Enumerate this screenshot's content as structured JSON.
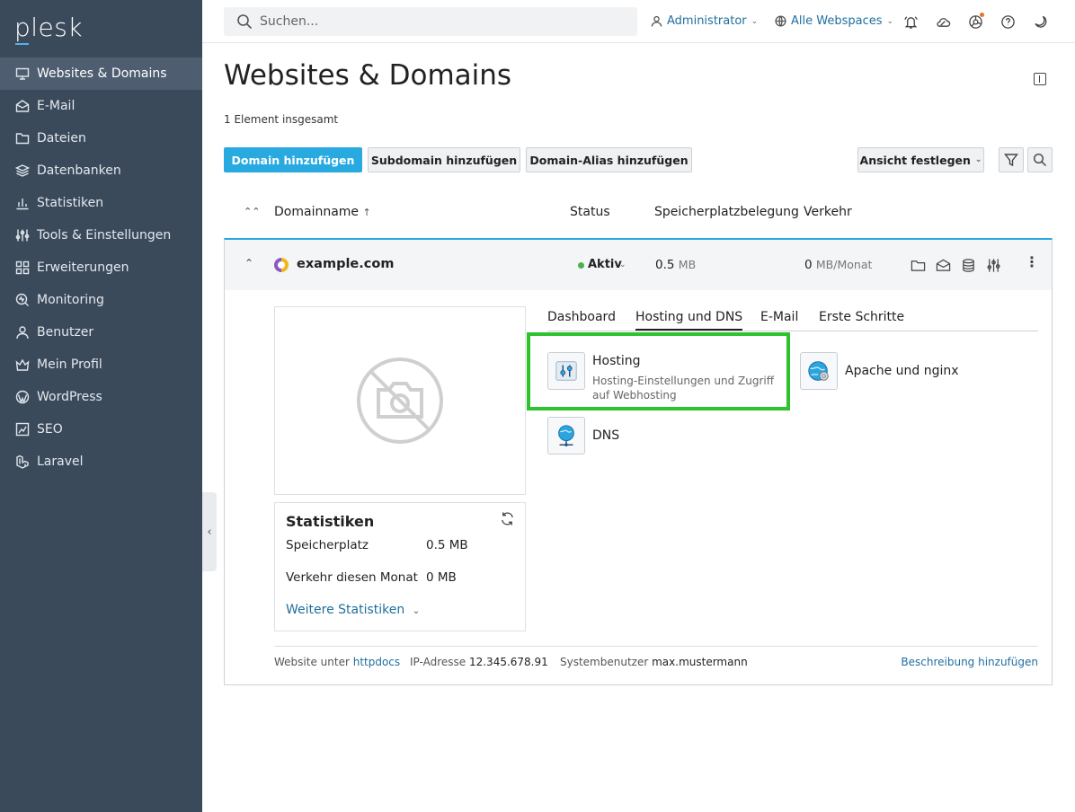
{
  "app": {
    "logo": "plesk"
  },
  "sidebar": {
    "items": [
      {
        "label": "Websites & Domains",
        "icon": "monitor-icon"
      },
      {
        "label": "E-Mail",
        "icon": "mail-icon"
      },
      {
        "label": "Dateien",
        "icon": "folder-icon"
      },
      {
        "label": "Datenbanken",
        "icon": "database-icon"
      },
      {
        "label": "Statistiken",
        "icon": "bar-chart-icon"
      },
      {
        "label": "Tools & Einstellungen",
        "icon": "sliders-icon"
      },
      {
        "label": "Erweiterungen",
        "icon": "grid-icon"
      },
      {
        "label": "Monitoring",
        "icon": "monitoring-icon"
      },
      {
        "label": "Benutzer",
        "icon": "user-icon"
      },
      {
        "label": "Mein Profil",
        "icon": "crown-icon"
      },
      {
        "label": "WordPress",
        "icon": "wordpress-icon"
      },
      {
        "label": "SEO",
        "icon": "seo-icon"
      },
      {
        "label": "Laravel",
        "icon": "laravel-icon"
      }
    ]
  },
  "topbar": {
    "search_placeholder": "Suchen...",
    "user": "Administrator",
    "webspaces": "Alle Webspaces"
  },
  "main": {
    "title": "Websites & Domains",
    "total": "1 Element insgesamt",
    "buttons": {
      "add_domain": "Domain hinzufügen",
      "add_subdomain": "Subdomain hinzufügen",
      "add_alias": "Domain-Alias hinzufügen",
      "view": "Ansicht festlegen"
    },
    "columns": {
      "domain": "Domainname",
      "domain_sort": "↑",
      "status": "Status",
      "storage": "Speicherplatzbelegung",
      "traffic": "Verkehr"
    }
  },
  "domain": {
    "name": "example.com",
    "status": "Aktiv",
    "storage_value": "0.5",
    "storage_unit": "MB",
    "traffic_value": "0",
    "traffic_unit": "MB/Monat",
    "tabs": [
      "Dashboard",
      "Hosting und DNS",
      "E-Mail",
      "Erste Schritte"
    ],
    "tools": {
      "hosting_title": "Hosting",
      "hosting_desc": "Hosting-Einstellungen und Zugriff auf Webhosting",
      "apache_title": "Apache und nginx",
      "dns_title": "DNS"
    },
    "stats": {
      "title": "Statistiken",
      "storage_label": "Speicherplatz",
      "storage_value": "0.5 MB",
      "traffic_label": "Verkehr diesen Monat",
      "traffic_value": "0 MB",
      "more": "Weitere Statistiken"
    },
    "footer": {
      "website_label": "Website unter",
      "website_value": "httpdocs",
      "ip_label": "IP-Adresse",
      "ip_value": "12.345.678.91",
      "sysuser_label": "Systembenutzer",
      "sysuser_value": "max.mustermann",
      "add_description": "Beschreibung hinzufügen"
    }
  },
  "colors": {
    "sidebar": "#3b4a5b",
    "accent": "#28aae1",
    "highlight": "#2fc22f",
    "status_active": "#4caf50"
  }
}
